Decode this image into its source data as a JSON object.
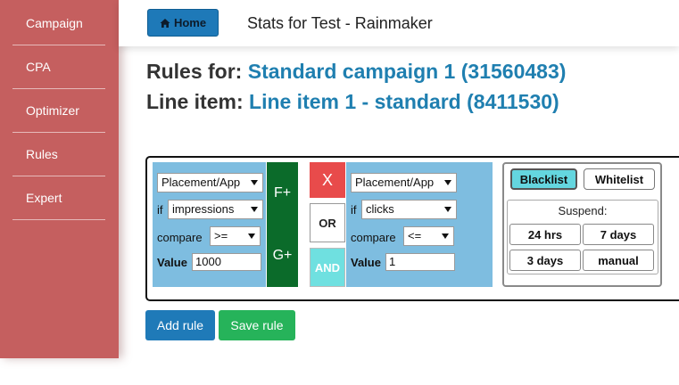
{
  "sidebar": {
    "items": [
      {
        "label": "Campaign"
      },
      {
        "label": "CPA"
      },
      {
        "label": "Optimizer"
      },
      {
        "label": "Rules"
      },
      {
        "label": "Expert"
      }
    ]
  },
  "header": {
    "home_label": "Home",
    "home_icon": "home-icon",
    "title": "Stats for Test - Rainmaker"
  },
  "headings": {
    "rules_prefix": "Rules for:",
    "rules_campaign": "Standard campaign 1 (31560483)",
    "line_prefix": "Line item:",
    "line_item": "Line item 1 - standard (8411530)"
  },
  "rule1": {
    "target": "Placement/App",
    "if_label": "if",
    "metric": "impressions",
    "compare_label": "compare",
    "operator": ">=",
    "value_label": "Value",
    "value": "1000"
  },
  "group_buttons": {
    "f_label": "F+",
    "g_label": "G+"
  },
  "logic_buttons": {
    "remove_label": "X",
    "or_label": "OR",
    "and_label": "AND"
  },
  "rule2": {
    "target": "Placement/App",
    "if_label": "if",
    "metric": "clicks",
    "compare_label": "compare",
    "operator": "<=",
    "value_label": "Value",
    "value": "1"
  },
  "list_panel": {
    "blacklist_label": "Blacklist",
    "whitelist_label": "Whitelist",
    "suspend_label": "Suspend:",
    "suspend_options": [
      "24 hrs",
      "7 days",
      "3 days",
      "manual"
    ]
  },
  "actions": {
    "add_rule_label": "Add rule",
    "save_rule_label": "Save rule"
  },
  "colors": {
    "sidebar": "#c55f5f",
    "accent": "#1f7fb0",
    "rule_panel": "#7ebde0",
    "group_button": "#0b6b2a",
    "remove_button": "#e84b4b",
    "and_button": "#6fe0e0",
    "blacklist_active": "#64d6df",
    "add_button": "#1f7ab8",
    "save_button": "#26b35a"
  }
}
